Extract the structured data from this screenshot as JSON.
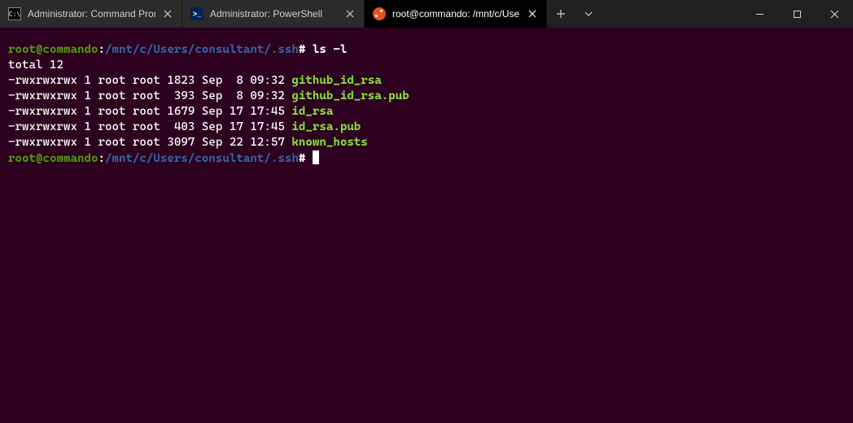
{
  "tabs": [
    {
      "label": "Administrator: Command Promp",
      "active": false,
      "icon": "cmd"
    },
    {
      "label": "Administrator: PowerShell",
      "active": false,
      "icon": "ps"
    },
    {
      "label": "root@commando: /mnt/c/Users",
      "active": true,
      "icon": "ubuntu"
    }
  ],
  "prompt": {
    "user_host": "root@commando",
    "path": "/mnt/c/Users/consultant/.ssh",
    "symbol": "#"
  },
  "command": "ls -l",
  "total_line": "total 12",
  "listing": [
    {
      "perm": "-rwxrwxrwx",
      "links": "1",
      "owner": "root",
      "group": "root",
      "size": "1823",
      "date": "Sep  8 09:32",
      "name": "github_id_rsa"
    },
    {
      "perm": "-rwxrwxrwx",
      "links": "1",
      "owner": "root",
      "group": "root",
      "size": " 393",
      "date": "Sep  8 09:32",
      "name": "github_id_rsa.pub"
    },
    {
      "perm": "-rwxrwxrwx",
      "links": "1",
      "owner": "root",
      "group": "root",
      "size": "1679",
      "date": "Sep 17 17:45",
      "name": "id_rsa"
    },
    {
      "perm": "-rwxrwxrwx",
      "links": "1",
      "owner": "root",
      "group": "root",
      "size": " 403",
      "date": "Sep 17 17:45",
      "name": "id_rsa.pub"
    },
    {
      "perm": "-rwxrwxrwx",
      "links": "1",
      "owner": "root",
      "group": "root",
      "size": "3097",
      "date": "Sep 22 12:57",
      "name": "known_hosts"
    }
  ]
}
